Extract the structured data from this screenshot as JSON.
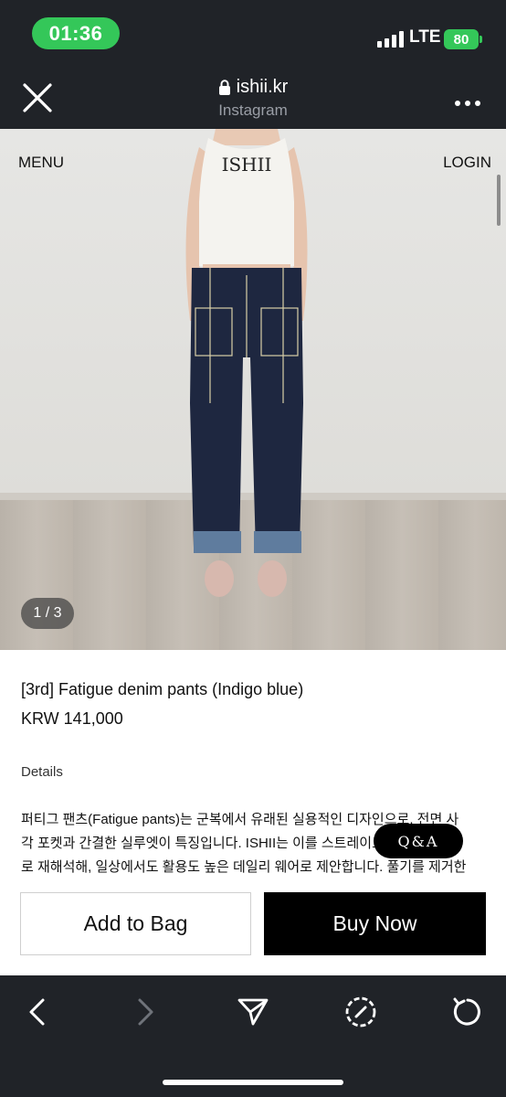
{
  "status_bar": {
    "time": "01:36",
    "network": "LTE",
    "battery": "80"
  },
  "browser": {
    "domain": "ishii.kr",
    "source_app": "Instagram"
  },
  "hero": {
    "menu_label": "MENU",
    "login_label": "LOGIN",
    "brand_on_shirt": "ISHII",
    "image_counter": "1 / 3"
  },
  "product": {
    "title": "[3rd] Fatigue denim pants (Indigo blue)",
    "price": "KRW 141,000",
    "details_label": "Details",
    "description_lines": [
      "퍼티그 팬츠(Fatigue pants)는 군복에서 유래된 실용적인 디자인으로, 전면 사",
      "각 포켓과 간결한 실루엣이 특징입니다. ISHII는 이를 스트레이트 데님 소재",
      "로 재해석해, 일상에서도 활용도 높은 데일리 웨어로 제안합니다. 풀기를 제거한"
    ]
  },
  "qa_button": "Q&A",
  "actions": {
    "add_to_bag": "Add to Bag",
    "buy_now": "Buy Now"
  },
  "icons": {
    "close": "close-icon",
    "more": "more-icon",
    "lock": "lock-icon",
    "back": "back-icon",
    "forward": "forward-icon",
    "share": "share-icon",
    "compass": "compass-icon",
    "reload": "reload-icon"
  },
  "colors": {
    "chrome": "#202328",
    "status_green": "#34c759",
    "buy_button": "#000000"
  }
}
